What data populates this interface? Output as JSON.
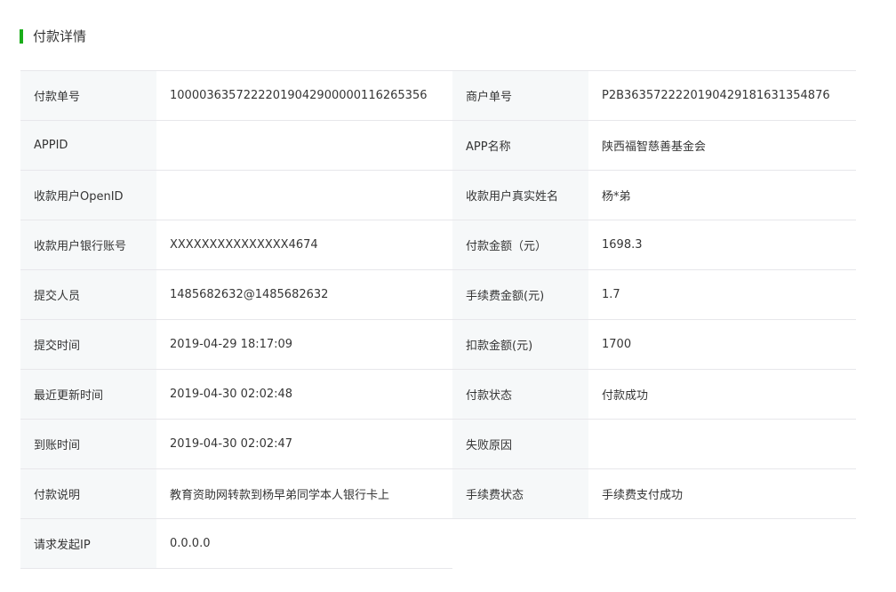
{
  "section": {
    "title": "付款详情",
    "accent_color": "#1aad19"
  },
  "rows": [
    {
      "left_label": "付款单号",
      "left_value": "1000036357222201904290000011626535​6",
      "right_label": "商户单号",
      "right_value": "P2B3635722220190429181631354876"
    },
    {
      "left_label": "APPID",
      "left_value": "",
      "right_label": "APP名称",
      "right_value": "陕西福智慈善基金会"
    },
    {
      "left_label": "收款用户OpenID",
      "left_value": "",
      "right_label": "收款用户真实姓名",
      "right_value": "杨*弟"
    },
    {
      "left_label": "收款用户银行账号",
      "left_value": "XXXXXXXXXXXXXXX4674",
      "right_label": "付款金额（元）",
      "right_value": "1698.3"
    },
    {
      "left_label": "提交人员",
      "left_value": "1485682632@1485682632",
      "right_label": "手续费金额(元)",
      "right_value": "1.7"
    },
    {
      "left_label": "提交时间",
      "left_value": "2019-04-29 18:17:09",
      "right_label": "扣款金额(元)",
      "right_value": "1700"
    },
    {
      "left_label": "最近更新时间",
      "left_value": "2019-04-30 02:02:48",
      "right_label": "付款状态",
      "right_value": "付款成功"
    },
    {
      "left_label": "到账时间",
      "left_value": "2019-04-30 02:02:47",
      "right_label": "失败原因",
      "right_value": ""
    },
    {
      "left_label": "付款说明",
      "left_value": "教育资助网转款到杨早弟同学本人银行卡上",
      "right_label": "手续费状态",
      "right_value": "手续费支付成功"
    },
    {
      "left_label": "请求发起IP",
      "left_value": "0.0.0.0"
    }
  ]
}
